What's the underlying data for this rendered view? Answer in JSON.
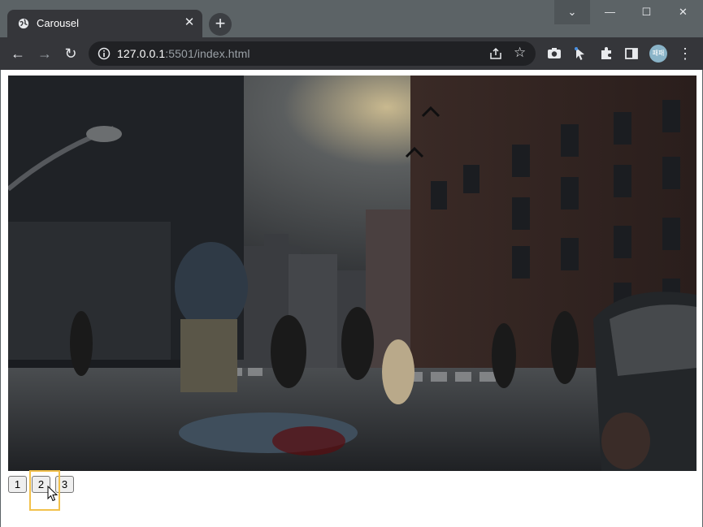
{
  "browser": {
    "tab": {
      "title": "Carousel",
      "favicon_icon": "globe-icon",
      "close_glyph": "✕"
    },
    "new_tab_glyph": "+",
    "window_controls": {
      "menu_glyph": "⌄",
      "minimize_glyph": "—",
      "maximize_glyph": "☐",
      "close_glyph": "✕"
    },
    "toolbar": {
      "back_glyph": "←",
      "forward_glyph": "→",
      "reload_glyph": "↻",
      "url_host": "127.0.0.1",
      "url_rest": ":5501/index.html",
      "star_glyph": "☆",
      "profile_label": "패패",
      "menu_glyph": "⋮"
    }
  },
  "page": {
    "carousel": {
      "image_alt": "Post-apocalyptic city street with zombies",
      "buttons": [
        "1",
        "2",
        "3"
      ],
      "active_index": 2
    }
  },
  "colors": {
    "tabstrip": "#5c6366",
    "toolbar": "#35363a",
    "highlight": "#f2c14b"
  }
}
